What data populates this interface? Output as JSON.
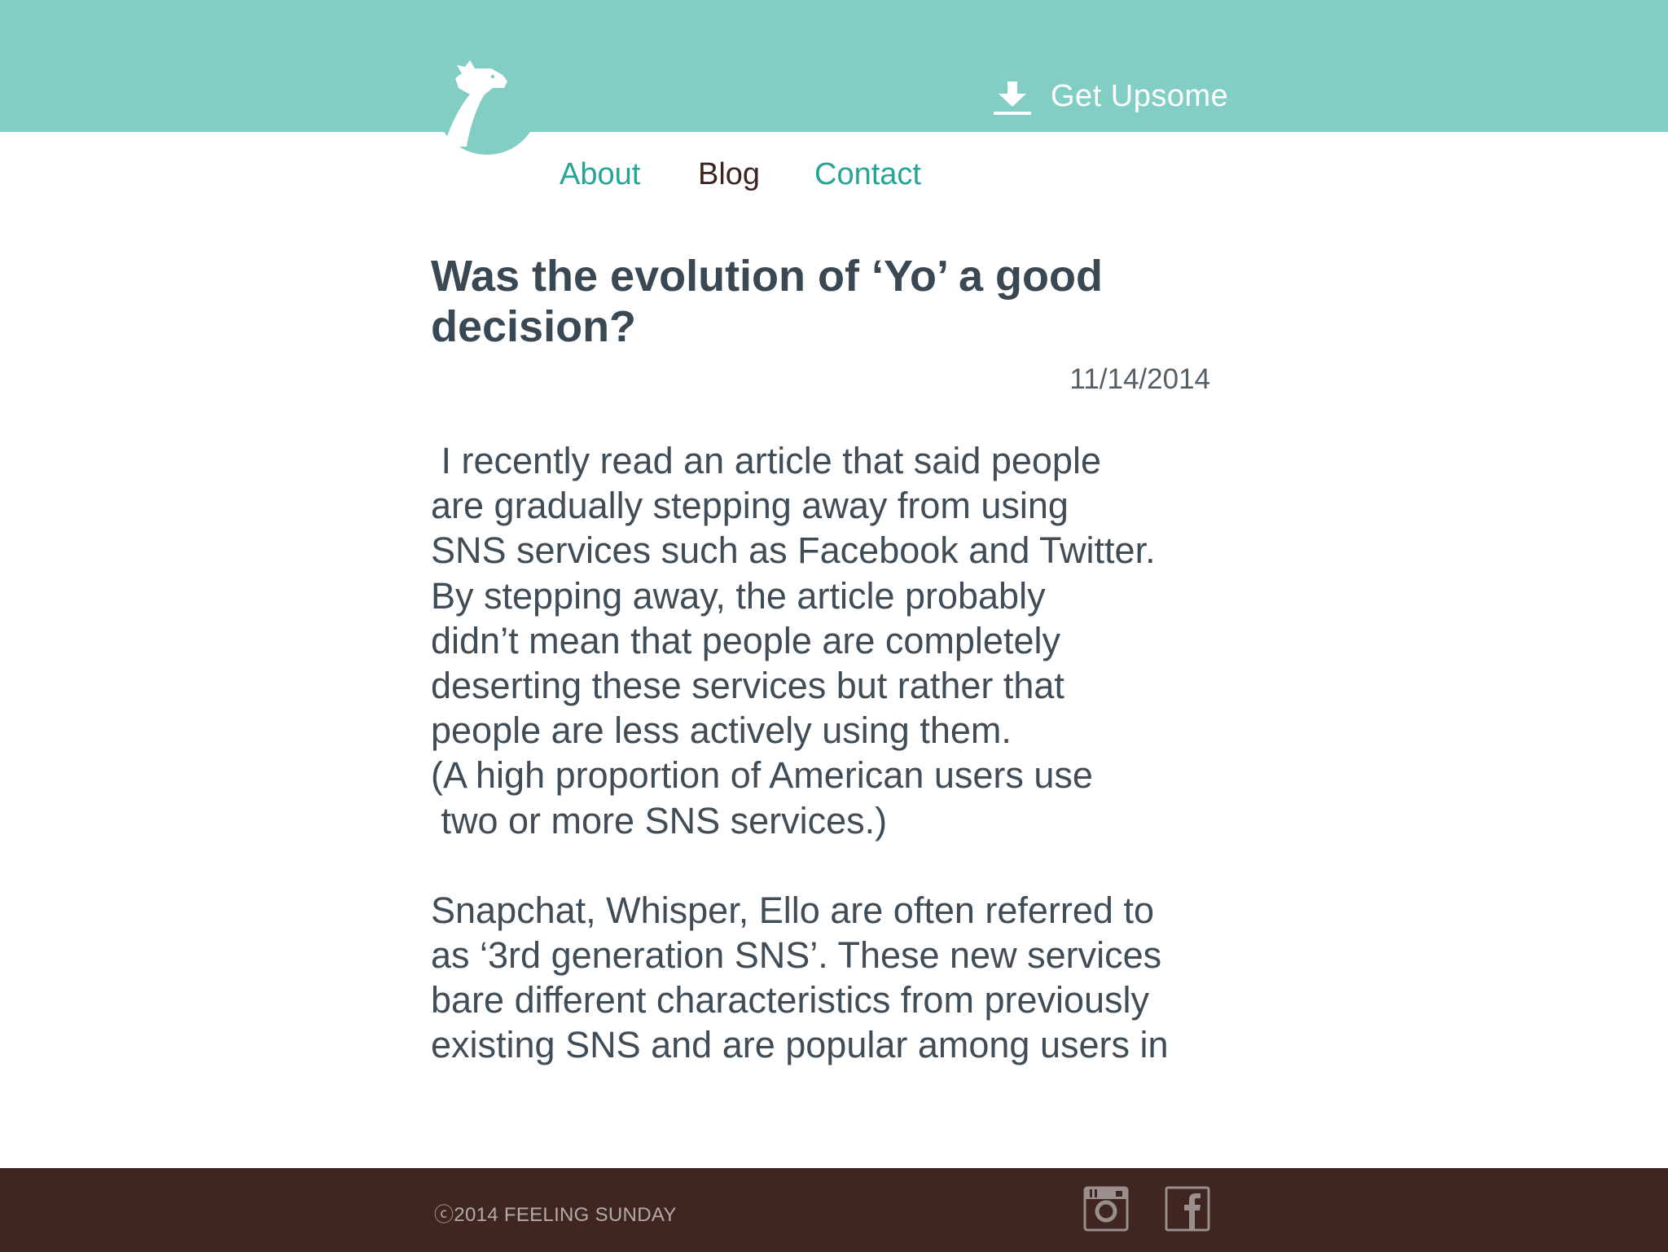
{
  "header": {
    "cta_label": "Get Upsome"
  },
  "nav": {
    "items": [
      {
        "label": "About"
      },
      {
        "label": "Blog"
      },
      {
        "label": "Contact"
      }
    ]
  },
  "article": {
    "title_line1": "Was the evolution of ‘Yo’ a good",
    "title_line2": "decision?",
    "date": "11/14/2014",
    "lines": [
      " I recently read an article that said people",
      "are gradually stepping away from using",
      "SNS services such as Facebook and Twitter.",
      "By stepping away, the article probably",
      "didn’t mean that people are completely",
      "deserting these services but rather that",
      "people are less actively using them.",
      "(A high proportion of American users use",
      " two or more SNS services.)",
      "",
      "Snapchat, Whisper, Ello are often referred to",
      "as ‘3rd generation SNS’. These new services",
      "bare different characteristics from previously",
      "existing SNS and are popular among users in"
    ]
  },
  "footer": {
    "copyright": "ⓒ2014 FEELING SUNDAY"
  },
  "icons": {
    "logo": "giraffe-logo-icon",
    "download": "download-icon",
    "instagram": "instagram-icon",
    "facebook": "facebook-icon"
  },
  "colors": {
    "header_bg": "#82cdc4",
    "nav_link": "#26a498",
    "nav_active": "#3d2420",
    "footer_bg": "#3f2621",
    "text": "#404c56"
  }
}
